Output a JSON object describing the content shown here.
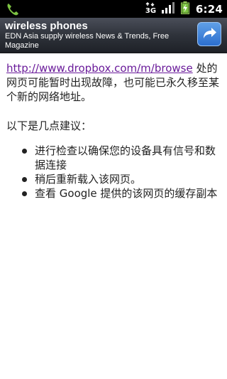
{
  "status_bar": {
    "time": "6:24",
    "network_label": "3G",
    "icons": [
      "phone-call-icon",
      "3g-data-icon",
      "signal-strength-icon",
      "battery-charging-icon"
    ]
  },
  "ad": {
    "title": "wireless phones",
    "description": "EDN Asia supply wireless News & Trends, Free Magazine",
    "button_icon": "share-arrow-icon",
    "accent_color": "#2c6fcf"
  },
  "page": {
    "url_link": "http://www.dropbox.com/m/browse",
    "message": " 处的网页可能暂时出现故障，也可能已永久移至某个新的网络地址。",
    "suggestions_title": "以下是几点建议：",
    "suggestions": [
      "进行检查以确保您的设备具有信号和数据连接",
      "稍后重新载入该网页。",
      "查看 Google 提供的该网页的缓存副本"
    ],
    "link_color": "#6a1b9a"
  }
}
